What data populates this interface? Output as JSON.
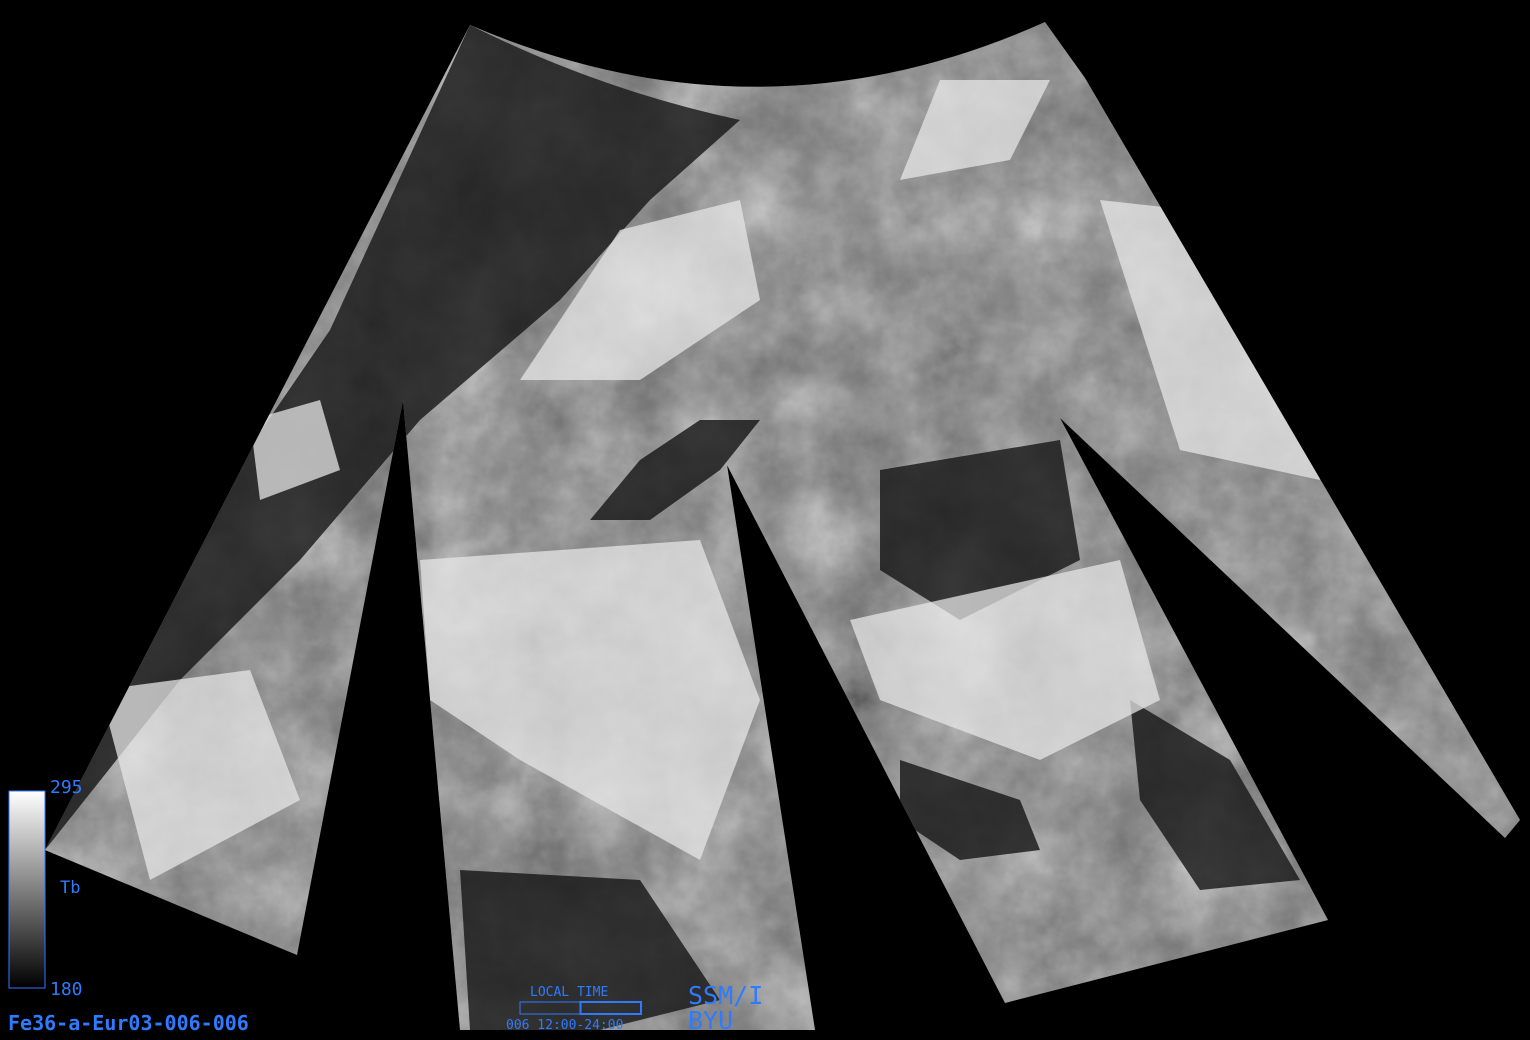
{
  "image_id": "Fe36-a-Eur03-006-006",
  "colorbar": {
    "max_label": "295",
    "variable_label": "Tb",
    "min_label": "180",
    "gradient_top": "#ffffff",
    "gradient_bottom": "#000000"
  },
  "local_time": {
    "title": "LOCAL TIME",
    "range": "006  12:00-24:00",
    "selected_fraction": 0.5
  },
  "sensor_label": "SSM/I",
  "org_label": "BYU",
  "colors": {
    "label": "#2f7bff",
    "background": "#000000"
  }
}
